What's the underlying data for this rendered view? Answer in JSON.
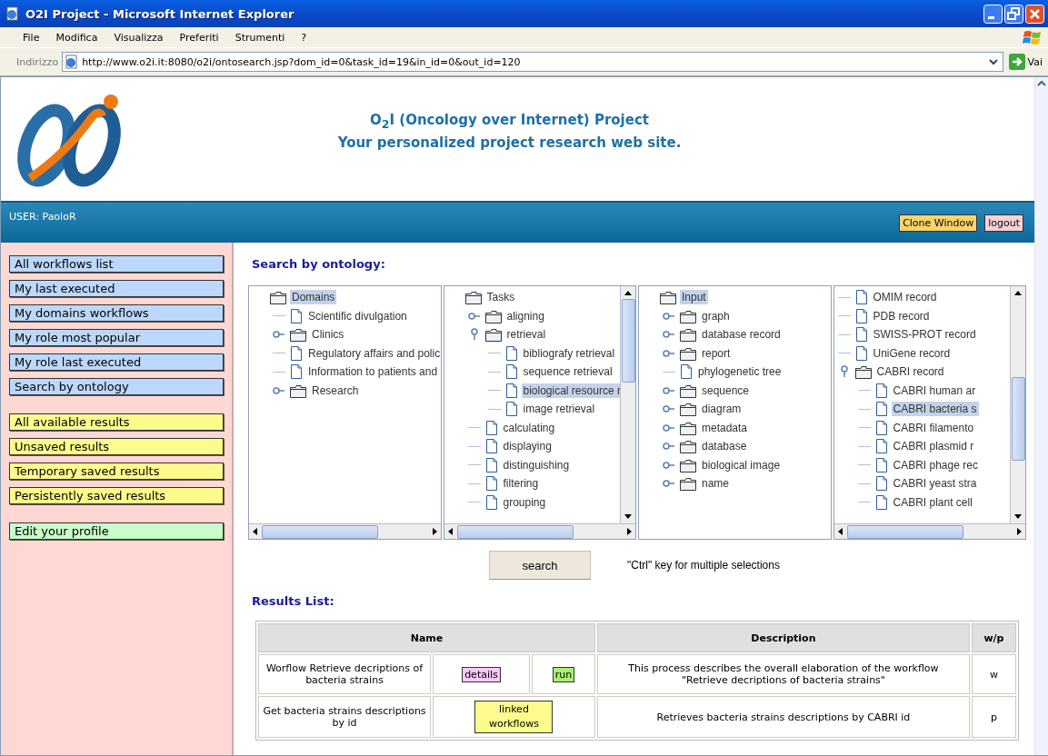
{
  "window": {
    "title": "O2I Project - Microsoft Internet Explorer"
  },
  "menu": [
    "File",
    "Modifica",
    "Visualizza",
    "Preferiti",
    "Strumenti",
    "?"
  ],
  "address_bar": {
    "label": "Indirizzo",
    "url": "http://www.o2i.it:8080/o2i/ontosearch.jsp?dom_id=0&task_id=19&in_id=0&out_id=120",
    "go": "Vai"
  },
  "header": {
    "title": "O$_{2}$I (Oncology over Internet) Project",
    "subtitle": "Your personalized project research web site."
  },
  "user_bar": {
    "user": "USER: PaoloR",
    "buttons": [
      {
        "label": "Clone Window",
        "kind": "clone"
      },
      {
        "label": "logout",
        "kind": "logout"
      }
    ]
  },
  "sidebar": {
    "groups": [
      {
        "kind": "workflows",
        "items": [
          "All workflows list",
          "My last executed",
          "My domains workflows",
          "My role most popular",
          "My role last executed",
          "Search by ontology"
        ]
      },
      {
        "kind": "results",
        "items": [
          "All available results",
          "Unsaved results",
          "Temporary saved results",
          "Persistently saved results"
        ]
      },
      {
        "kind": "profile",
        "items": [
          "Edit your profile"
        ]
      }
    ]
  },
  "search": {
    "heading": "Search by ontology:",
    "panels": [
      {
        "vscroll": false,
        "hscroll": true,
        "tree": [
          {
            "label": "Domains",
            "kind": "folder",
            "selected": true,
            "children": [
              {
                "label": "Scientific divulgation",
                "kind": "leaf",
                "selected": false
              },
              {
                "label": "Clinics",
                "kind": "folder",
                "expanded": false,
                "selected": false
              },
              {
                "label": "Regulatory affairs and polic",
                "kind": "leaf",
                "selected": false
              },
              {
                "label": "Information to patients and",
                "kind": "leaf",
                "selected": false
              },
              {
                "label": "Research",
                "kind": "folder",
                "expanded": false,
                "selected": false
              }
            ]
          }
        ]
      },
      {
        "vscroll": true,
        "hscroll": true,
        "tree": [
          {
            "label": "Tasks",
            "kind": "folder",
            "selected": false,
            "children": [
              {
                "label": "aligning",
                "kind": "folder",
                "expanded": false,
                "selected": false
              },
              {
                "label": "retrieval",
                "kind": "folder",
                "expanded": true,
                "selected": false,
                "children": [
                  {
                    "label": "bibliografy retrieval",
                    "kind": "leaf",
                    "selected": false
                  },
                  {
                    "label": "sequence retrieval",
                    "kind": "leaf",
                    "selected": false
                  },
                  {
                    "label": "biological resource r",
                    "kind": "leaf",
                    "selected": true
                  },
                  {
                    "label": "image retrieval",
                    "kind": "leaf",
                    "selected": false
                  }
                ]
              },
              {
                "label": "calculating",
                "kind": "leaf",
                "selected": false
              },
              {
                "label": "displaying",
                "kind": "leaf",
                "selected": false
              },
              {
                "label": "distinguishing",
                "kind": "leaf",
                "selected": false
              },
              {
                "label": "filtering",
                "kind": "leaf",
                "selected": false
              },
              {
                "label": "grouping",
                "kind": "leaf",
                "selected": false
              }
            ]
          }
        ]
      },
      {
        "vscroll": false,
        "hscroll": false,
        "tree": [
          {
            "label": "Input",
            "kind": "folder",
            "selected": true,
            "children": [
              {
                "label": "graph",
                "kind": "folder",
                "expanded": false,
                "selected": false
              },
              {
                "label": "database record",
                "kind": "folder",
                "expanded": false,
                "selected": false
              },
              {
                "label": "report",
                "kind": "folder",
                "expanded": false,
                "selected": false
              },
              {
                "label": "phylogenetic tree",
                "kind": "leaf",
                "selected": false
              },
              {
                "label": "sequence",
                "kind": "folder",
                "expanded": false,
                "selected": false
              },
              {
                "label": "diagram",
                "kind": "folder",
                "expanded": false,
                "selected": false
              },
              {
                "label": "metadata",
                "kind": "folder",
                "expanded": false,
                "selected": false
              },
              {
                "label": "database",
                "kind": "folder",
                "expanded": false,
                "selected": false
              },
              {
                "label": "biological image",
                "kind": "folder",
                "expanded": false,
                "selected": false
              },
              {
                "label": "name",
                "kind": "folder",
                "expanded": false,
                "selected": false
              }
            ]
          }
        ]
      },
      {
        "vscroll": true,
        "hscroll": true,
        "tree": [
          {
            "label": "OMIM record",
            "kind": "leaf",
            "selected": false
          },
          {
            "label": "PDB record",
            "kind": "leaf",
            "selected": false
          },
          {
            "label": "SWISS-PROT record",
            "kind": "leaf",
            "selected": false
          },
          {
            "label": "UniGene record",
            "kind": "leaf",
            "selected": false
          },
          {
            "label": "CABRI record",
            "kind": "folder",
            "expanded": true,
            "selected": false,
            "children": [
              {
                "label": "CABRI human ar",
                "kind": "leaf",
                "selected": false
              },
              {
                "label": "CABRI bacteria s",
                "kind": "leaf",
                "selected": true
              },
              {
                "label": "CABRI filamento",
                "kind": "leaf",
                "selected": false
              },
              {
                "label": "CABRI plasmid r",
                "kind": "leaf",
                "selected": false
              },
              {
                "label": "CABRI phage rec",
                "kind": "leaf",
                "selected": false
              },
              {
                "label": "CABRI yeast stra",
                "kind": "leaf",
                "selected": false
              },
              {
                "label": "CABRI plant cell",
                "kind": "leaf",
                "selected": false
              }
            ]
          }
        ]
      }
    ],
    "button": "search",
    "hint": "\"Ctrl\" key for multiple selections"
  },
  "results": {
    "heading": "Results List:",
    "columns": [
      "Name",
      "Description",
      "w/p"
    ],
    "rows": [
      {
        "name": "Worflow Retrieve decriptions of bacteria strains",
        "actions": [
          {
            "label": "details",
            "kind": "details"
          },
          {
            "label": "run",
            "kind": "run"
          }
        ],
        "description": "This process describes the overall elaboration of the workflow\n\"Retrieve decriptions of bacteria strains\"",
        "type": "w"
      },
      {
        "name": "Get bacteria strains descriptions by id",
        "actions": [
          {
            "label": "linked workflows",
            "kind": "linked"
          }
        ],
        "description": "Retrieves bacteria strains descriptions by CABRI id",
        "type": "p"
      }
    ]
  }
}
